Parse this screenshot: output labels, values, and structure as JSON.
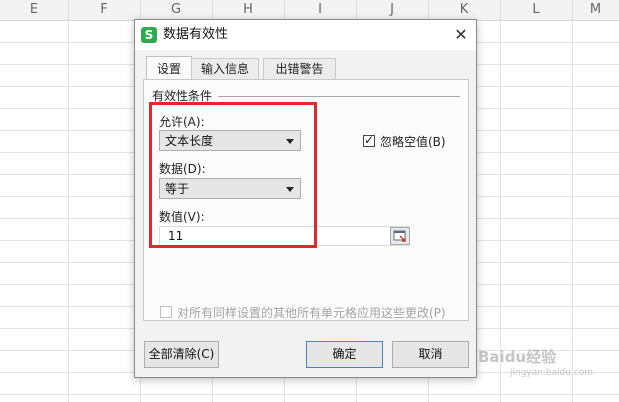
{
  "sheet": {
    "columns": [
      "E",
      "F",
      "G",
      "H",
      "I",
      "J",
      "K",
      "L",
      "M"
    ]
  },
  "dialog": {
    "icon_letter": "S",
    "title": "数据有效性",
    "close_glyph": "✕",
    "tabs": [
      {
        "label": "设置",
        "active": true
      },
      {
        "label": "输入信息",
        "active": false
      },
      {
        "label": "出错警告",
        "active": false
      }
    ],
    "settings": {
      "group_label": "有效性条件",
      "allow_label": "允许(A):",
      "allow_value": "文本长度",
      "ignore_blank_label": "忽略空值(B)",
      "ignore_blank_checked": true,
      "data_label": "数据(D):",
      "data_value": "等于",
      "value_label": "数值(V):",
      "value_input": "11",
      "apply_all_label": "对所有同样设置的其他所有单元格应用这些更改(P)",
      "apply_all_checked": false
    },
    "buttons": {
      "clear_all": "全部清除(C)",
      "ok": "确定",
      "cancel": "取消"
    }
  },
  "watermark": {
    "text": "Baidu经验",
    "sub": "jingyan.baidu.com"
  },
  "colors": {
    "highlight": "#e5262a",
    "app_icon": "#2fa84f"
  }
}
